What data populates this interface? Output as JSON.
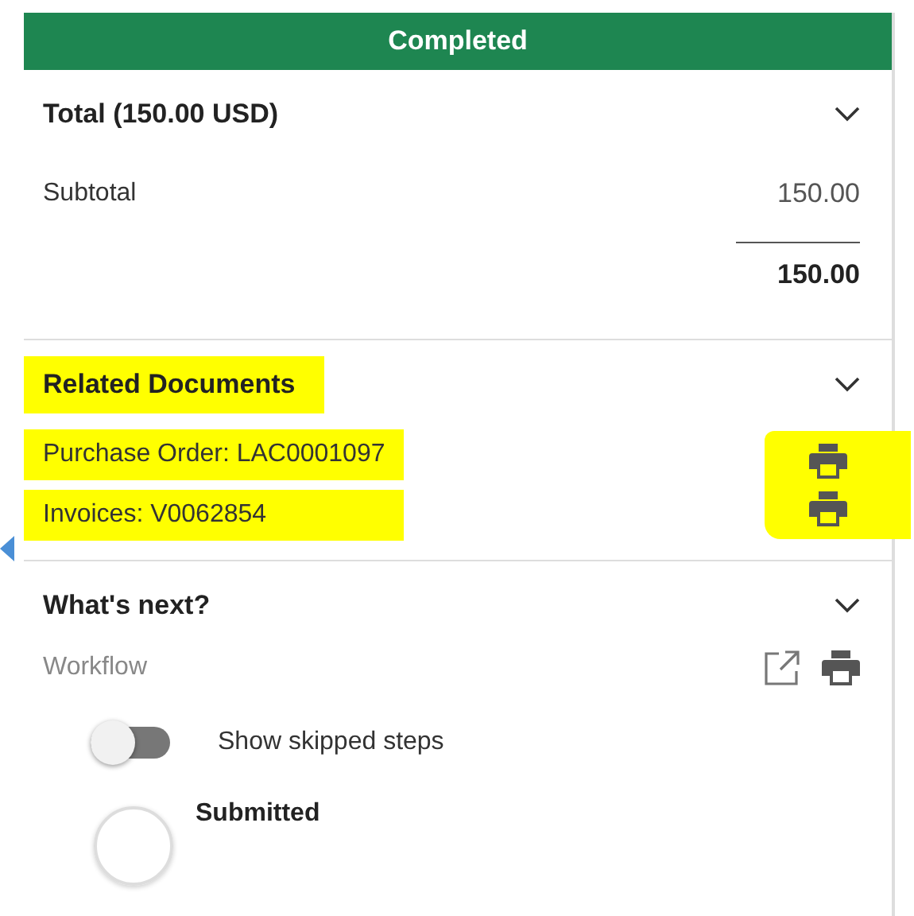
{
  "status_banner": "Completed",
  "total": {
    "title": "Total (150.00 USD)",
    "subtotal_label": "Subtotal",
    "subtotal_value": "150.00",
    "total_value": "150.00"
  },
  "related_documents": {
    "title": "Related Documents",
    "highlighted": true,
    "print_icons_highlighted": true,
    "documents": [
      {
        "label": "Purchase Order: LAC0001097",
        "highlighted": true
      },
      {
        "label": "Invoices: V0062854",
        "highlighted": true
      }
    ]
  },
  "whats_next": {
    "title": "What's next?",
    "workflow_label": "Workflow",
    "toggle": {
      "label": "Show skipped steps",
      "on": false
    },
    "steps": [
      {
        "label": "Submitted"
      }
    ]
  }
}
